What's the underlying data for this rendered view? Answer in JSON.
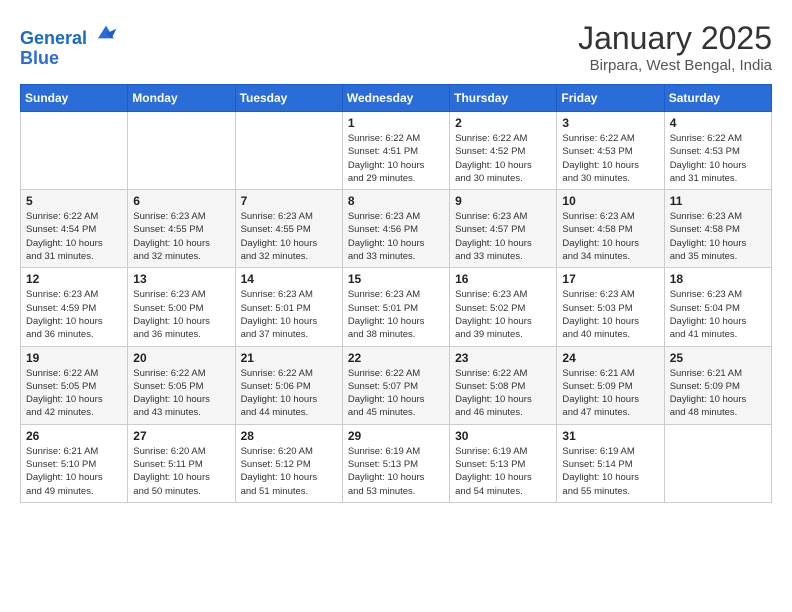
{
  "logo": {
    "line1": "General",
    "line2": "Blue"
  },
  "title": "January 2025",
  "location": "Birpara, West Bengal, India",
  "weekdays": [
    "Sunday",
    "Monday",
    "Tuesday",
    "Wednesday",
    "Thursday",
    "Friday",
    "Saturday"
  ],
  "weeks": [
    [
      {
        "day": "",
        "info": ""
      },
      {
        "day": "",
        "info": ""
      },
      {
        "day": "",
        "info": ""
      },
      {
        "day": "1",
        "info": "Sunrise: 6:22 AM\nSunset: 4:51 PM\nDaylight: 10 hours\nand 29 minutes."
      },
      {
        "day": "2",
        "info": "Sunrise: 6:22 AM\nSunset: 4:52 PM\nDaylight: 10 hours\nand 30 minutes."
      },
      {
        "day": "3",
        "info": "Sunrise: 6:22 AM\nSunset: 4:53 PM\nDaylight: 10 hours\nand 30 minutes."
      },
      {
        "day": "4",
        "info": "Sunrise: 6:22 AM\nSunset: 4:53 PM\nDaylight: 10 hours\nand 31 minutes."
      }
    ],
    [
      {
        "day": "5",
        "info": "Sunrise: 6:22 AM\nSunset: 4:54 PM\nDaylight: 10 hours\nand 31 minutes."
      },
      {
        "day": "6",
        "info": "Sunrise: 6:23 AM\nSunset: 4:55 PM\nDaylight: 10 hours\nand 32 minutes."
      },
      {
        "day": "7",
        "info": "Sunrise: 6:23 AM\nSunset: 4:55 PM\nDaylight: 10 hours\nand 32 minutes."
      },
      {
        "day": "8",
        "info": "Sunrise: 6:23 AM\nSunset: 4:56 PM\nDaylight: 10 hours\nand 33 minutes."
      },
      {
        "day": "9",
        "info": "Sunrise: 6:23 AM\nSunset: 4:57 PM\nDaylight: 10 hours\nand 33 minutes."
      },
      {
        "day": "10",
        "info": "Sunrise: 6:23 AM\nSunset: 4:58 PM\nDaylight: 10 hours\nand 34 minutes."
      },
      {
        "day": "11",
        "info": "Sunrise: 6:23 AM\nSunset: 4:58 PM\nDaylight: 10 hours\nand 35 minutes."
      }
    ],
    [
      {
        "day": "12",
        "info": "Sunrise: 6:23 AM\nSunset: 4:59 PM\nDaylight: 10 hours\nand 36 minutes."
      },
      {
        "day": "13",
        "info": "Sunrise: 6:23 AM\nSunset: 5:00 PM\nDaylight: 10 hours\nand 36 minutes."
      },
      {
        "day": "14",
        "info": "Sunrise: 6:23 AM\nSunset: 5:01 PM\nDaylight: 10 hours\nand 37 minutes."
      },
      {
        "day": "15",
        "info": "Sunrise: 6:23 AM\nSunset: 5:01 PM\nDaylight: 10 hours\nand 38 minutes."
      },
      {
        "day": "16",
        "info": "Sunrise: 6:23 AM\nSunset: 5:02 PM\nDaylight: 10 hours\nand 39 minutes."
      },
      {
        "day": "17",
        "info": "Sunrise: 6:23 AM\nSunset: 5:03 PM\nDaylight: 10 hours\nand 40 minutes."
      },
      {
        "day": "18",
        "info": "Sunrise: 6:23 AM\nSunset: 5:04 PM\nDaylight: 10 hours\nand 41 minutes."
      }
    ],
    [
      {
        "day": "19",
        "info": "Sunrise: 6:22 AM\nSunset: 5:05 PM\nDaylight: 10 hours\nand 42 minutes."
      },
      {
        "day": "20",
        "info": "Sunrise: 6:22 AM\nSunset: 5:05 PM\nDaylight: 10 hours\nand 43 minutes."
      },
      {
        "day": "21",
        "info": "Sunrise: 6:22 AM\nSunset: 5:06 PM\nDaylight: 10 hours\nand 44 minutes."
      },
      {
        "day": "22",
        "info": "Sunrise: 6:22 AM\nSunset: 5:07 PM\nDaylight: 10 hours\nand 45 minutes."
      },
      {
        "day": "23",
        "info": "Sunrise: 6:22 AM\nSunset: 5:08 PM\nDaylight: 10 hours\nand 46 minutes."
      },
      {
        "day": "24",
        "info": "Sunrise: 6:21 AM\nSunset: 5:09 PM\nDaylight: 10 hours\nand 47 minutes."
      },
      {
        "day": "25",
        "info": "Sunrise: 6:21 AM\nSunset: 5:09 PM\nDaylight: 10 hours\nand 48 minutes."
      }
    ],
    [
      {
        "day": "26",
        "info": "Sunrise: 6:21 AM\nSunset: 5:10 PM\nDaylight: 10 hours\nand 49 minutes."
      },
      {
        "day": "27",
        "info": "Sunrise: 6:20 AM\nSunset: 5:11 PM\nDaylight: 10 hours\nand 50 minutes."
      },
      {
        "day": "28",
        "info": "Sunrise: 6:20 AM\nSunset: 5:12 PM\nDaylight: 10 hours\nand 51 minutes."
      },
      {
        "day": "29",
        "info": "Sunrise: 6:19 AM\nSunset: 5:13 PM\nDaylight: 10 hours\nand 53 minutes."
      },
      {
        "day": "30",
        "info": "Sunrise: 6:19 AM\nSunset: 5:13 PM\nDaylight: 10 hours\nand 54 minutes."
      },
      {
        "day": "31",
        "info": "Sunrise: 6:19 AM\nSunset: 5:14 PM\nDaylight: 10 hours\nand 55 minutes."
      },
      {
        "day": "",
        "info": ""
      }
    ]
  ]
}
